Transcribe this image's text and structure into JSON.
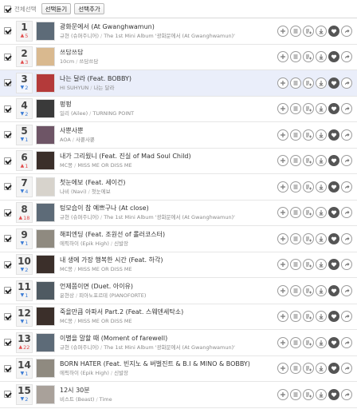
{
  "toolbar": {
    "select_all_label": "전체선택",
    "listen_label": "선택듣기",
    "add_label": "선택추가"
  },
  "songs": [
    {
      "rank": "1",
      "change_dir": "up",
      "change": "5",
      "title": "광화문에서 (At Gwanghwamun)",
      "artist": "규현 (슈퍼주니어)",
      "album": "The 1st Mini Album '광화문에서 (At Gwanghwamun)'",
      "cover": "#5d6b78",
      "checked": true,
      "highlight": false
    },
    {
      "rank": "2",
      "change_dir": "up",
      "change": "3",
      "title": "쓰담쓰담",
      "artist": "10cm",
      "album": "쓰담쓰담",
      "cover": "#d9b98f",
      "checked": true,
      "highlight": false
    },
    {
      "rank": "3",
      "change_dir": "down",
      "change": "2",
      "title": "나는 달라 (Feat. BOBBY)",
      "artist": "HI SUHYUN",
      "album": "나는 달라",
      "cover": "#b43a3a",
      "checked": true,
      "highlight": true
    },
    {
      "rank": "4",
      "change_dir": "down",
      "change": "2",
      "title": "펑펑",
      "artist": "일리 (Ailee)",
      "album": "TURNING POINT",
      "cover": "#3a3a3a",
      "checked": true,
      "highlight": false
    },
    {
      "rank": "5",
      "change_dir": "down",
      "change": "1",
      "title": "사뿐사뿐",
      "artist": "AOA",
      "album": "사뿐사뿐",
      "cover": "#6e5566",
      "checked": true,
      "highlight": false
    },
    {
      "rank": "6",
      "change_dir": "up",
      "change": "1",
      "title": "내가 그리웠니 (Feat. 진실 of Mad Soul Child)",
      "artist": "MC몽",
      "album": "MISS ME OR DISS ME",
      "cover": "#3b2f2a",
      "checked": true,
      "highlight": false
    },
    {
      "rank": "7",
      "change_dir": "down",
      "change": "4",
      "title": "첫눈에보 (Feat. 세이건)",
      "artist": "나비 (Navi)",
      "album": "첫눈에보",
      "cover": "#d7d3cc",
      "checked": true,
      "highlight": false
    },
    {
      "rank": "8",
      "change_dir": "up",
      "change": "18",
      "title": "텅모습이 참 예쁘구나 (At close)",
      "artist": "규현 (슈퍼주니어)",
      "album": "The 1st Mini Album '광화문에서 (At Gwanghwamun)'",
      "cover": "#5d6b78",
      "checked": true,
      "highlight": false
    },
    {
      "rank": "9",
      "change_dir": "down",
      "change": "1",
      "title": "해피엔딩 (Feat. 조원선 of 롤러코스터)",
      "artist": "에픽하이 (Epik High)",
      "album": "신발장",
      "cover": "#8f8a80",
      "checked": true,
      "highlight": false
    },
    {
      "rank": "10",
      "change_dir": "down",
      "change": "2",
      "title": "내 생에 가장 행복한 시간 (Feat. 하각)",
      "artist": "MC몽",
      "album": "MISS ME OR DISS ME",
      "cover": "#3b2f2a",
      "checked": true,
      "highlight": false
    },
    {
      "rank": "11",
      "change_dir": "down",
      "change": "1",
      "title": "언제쯤이면 (Duet. 아이유)",
      "artist": "윤현상",
      "album": "피아노포르테 (PIANOFORTE)",
      "cover": "#4f5a62",
      "checked": true,
      "highlight": false
    },
    {
      "rank": "12",
      "change_dir": "down",
      "change": "1",
      "title": "죽을만큼 아파서 Part.2 (Feat. 스웨덴세탁소)",
      "artist": "MC몽",
      "album": "MISS ME OR DISS ME",
      "cover": "#3b2f2a",
      "checked": true,
      "highlight": false
    },
    {
      "rank": "13",
      "change_dir": "up",
      "change": "22",
      "title": "이별을 말할 때 (Moment of farewell)",
      "artist": "규현 (슈퍼주니어)",
      "album": "The 1st Mini Album '광화문에서 (At Gwanghwamun)'",
      "cover": "#5d6b78",
      "checked": true,
      "highlight": false
    },
    {
      "rank": "14",
      "change_dir": "down",
      "change": "1",
      "title": "BORN HATER (Feat. 빈지노 & 버벌진트 & B.I & MINO & BOBBY)",
      "artist": "에픽하이 (Epik High)",
      "album": "신발장",
      "cover": "#8f8a80",
      "checked": true,
      "highlight": false
    },
    {
      "rank": "15",
      "change_dir": "down",
      "change": "2",
      "title": "12시 30분",
      "artist": "비스트 (Beast)",
      "album": "Time",
      "cover": "#a9a19a",
      "checked": true,
      "highlight": false
    }
  ],
  "actions": [
    "play-icon",
    "add-to-list-icon",
    "add-to-playlist-icon",
    "download-icon",
    "like-icon",
    "share-icon"
  ]
}
